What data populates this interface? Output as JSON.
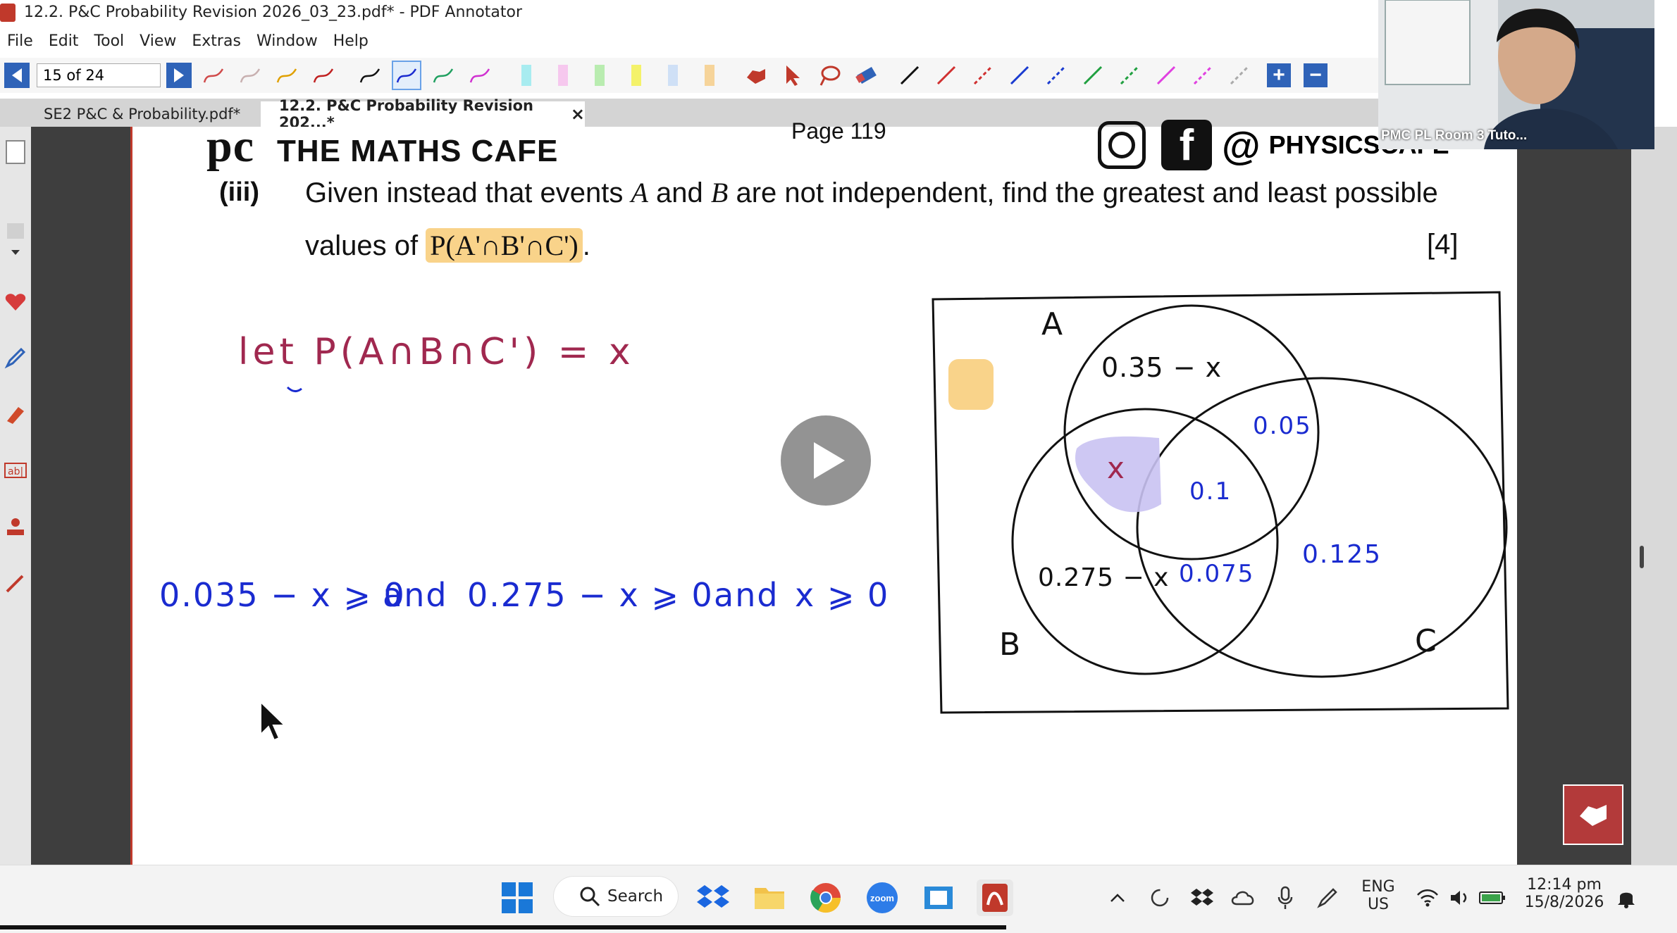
{
  "window": {
    "title": "12.2. P&C Probability Revision 2026_03_23.pdf* - PDF Annotator"
  },
  "menu": [
    "File",
    "Edit",
    "Tool",
    "View",
    "Extras",
    "Window",
    "Help"
  ],
  "toolbar": {
    "page_field": "15 of 24"
  },
  "tabs": [
    {
      "label": "SE2 P&C & Probability.pdf*"
    },
    {
      "label": "12.2. P&C Probability Revision 202...*",
      "close": "×"
    }
  ],
  "page": {
    "brand": "THE MATHS CAFE",
    "page_label": "Page 119",
    "social": "PHYSICSCAFE",
    "question": {
      "number": "(iii)",
      "line1_a": "Given instead that events ",
      "event_a": "A",
      "line1_b": " and ",
      "event_b": "B",
      "line1_c": " are not independent, find the greatest and least possible",
      "line2_a": "values of ",
      "expression": "P(A'∩B'∩C')",
      "line2_b": ".",
      "marks": "[4]"
    },
    "handwriting": {
      "let_line": "let P(A∩B∩C') = x",
      "inequalities": [
        "0.035 − x ⩾ 0",
        "and",
        "0.275 − x ⩾ 0",
        "and",
        "x ⩾ 0"
      ]
    },
    "venn": {
      "label_a": "A",
      "label_b": "B",
      "label_c": "C",
      "a_only": "0.35 − x",
      "ab_only": "x",
      "ac_only": "0.05",
      "abc": "0.1",
      "b_only": "0.275 − x",
      "bc_only": "0.075",
      "c_only": "0.125"
    }
  },
  "webcam": {
    "label": "PMC PL Room 3 Tuto..."
  },
  "taskbar": {
    "search": "Search",
    "lang_1": "ENG",
    "lang_2": "US",
    "time": "12:14 pm",
    "date": "15/8/2026"
  },
  "colors": {
    "accent": "#2f63b8",
    "ink_red": "#a0284f",
    "ink_blue": "#1a2bd0",
    "highlight": "#f9d38a"
  }
}
